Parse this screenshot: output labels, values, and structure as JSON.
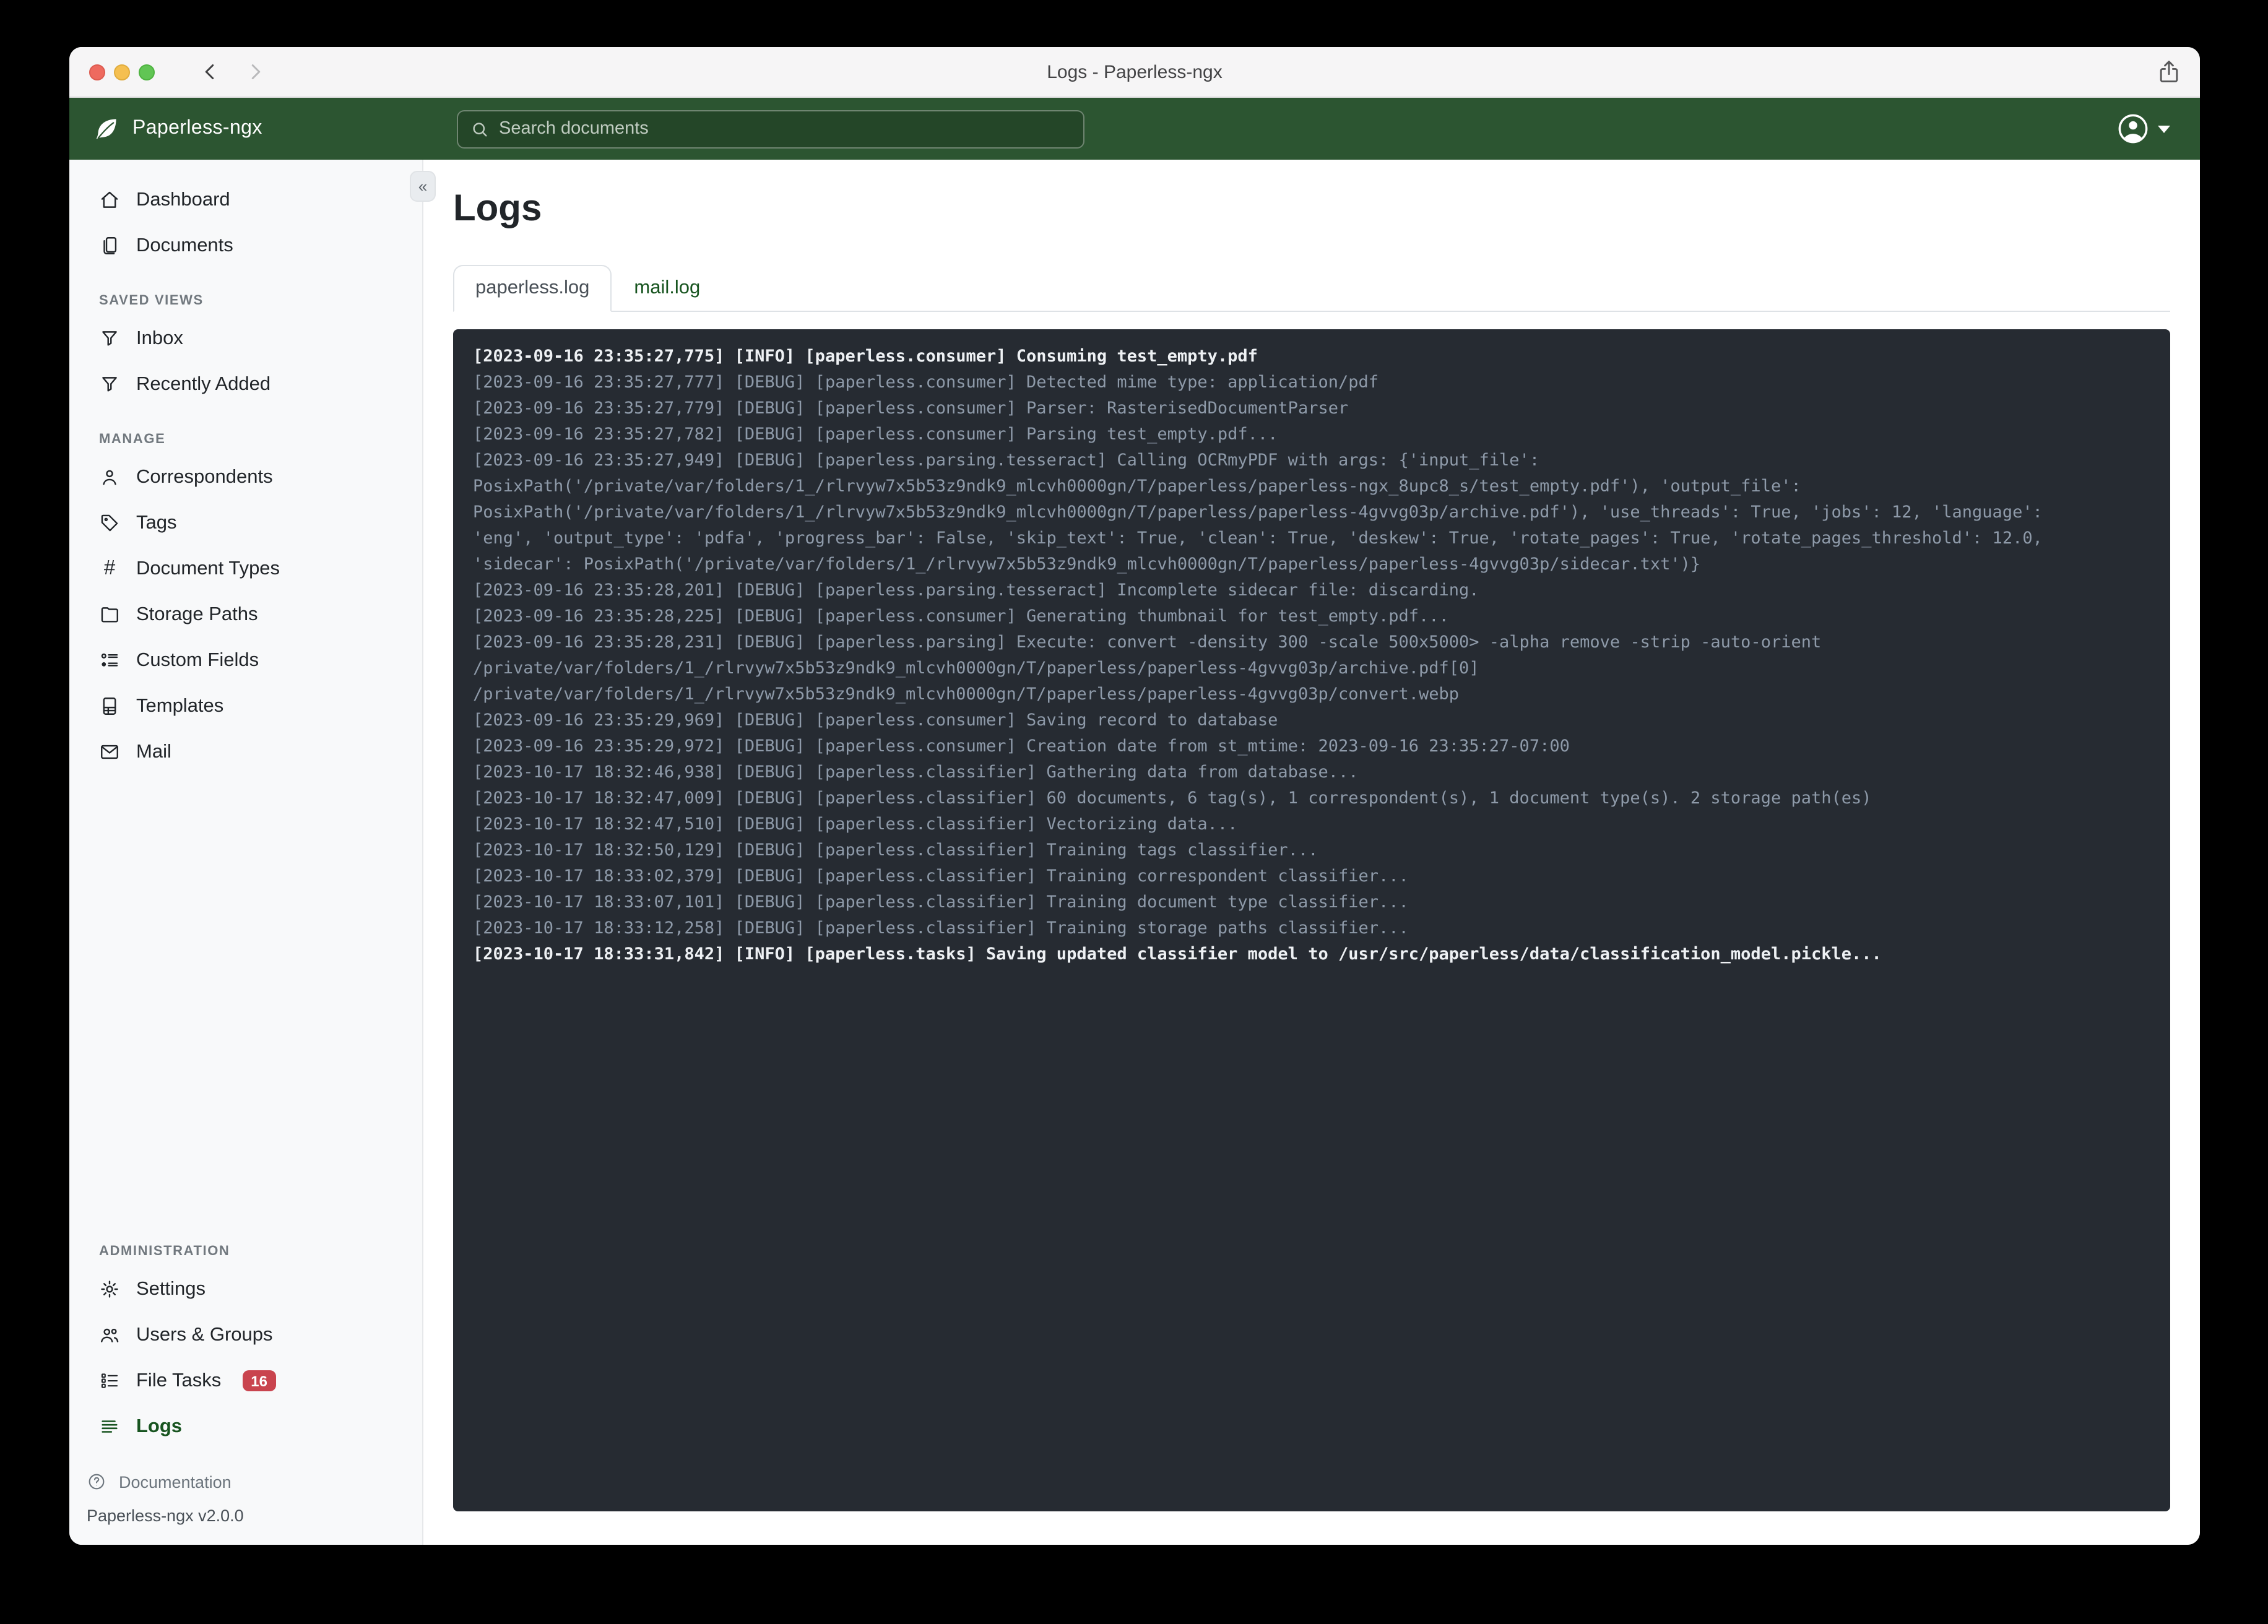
{
  "window": {
    "title": "Logs - Paperless-ngx"
  },
  "header": {
    "brand": "Paperless-ngx",
    "search": {
      "placeholder": "Search documents"
    }
  },
  "colors": {
    "navbar_green": "#2c5531",
    "accent_green": "#17541f",
    "badge_red": "#c9444e",
    "log_background": "#262b32",
    "log_debug_text": "#8e9aa9",
    "log_info_text": "#eef1f4",
    "sidebar_background": "#f8f9fa"
  },
  "sidebar": {
    "primary": [
      {
        "label": "Dashboard",
        "icon": "house-icon"
      },
      {
        "label": "Documents",
        "icon": "files-icon"
      }
    ],
    "saved_views_heading": "SAVED VIEWS",
    "saved_views": [
      {
        "label": "Inbox",
        "icon": "funnel-icon"
      },
      {
        "label": "Recently Added",
        "icon": "funnel-icon"
      }
    ],
    "manage_heading": "MANAGE",
    "manage": [
      {
        "label": "Correspondents",
        "icon": "person-icon"
      },
      {
        "label": "Tags",
        "icon": "tag-icon"
      },
      {
        "label": "Document Types",
        "icon": "hash-icon"
      },
      {
        "label": "Storage Paths",
        "icon": "folder-icon"
      },
      {
        "label": "Custom Fields",
        "icon": "ui-radios-icon"
      },
      {
        "label": "Templates",
        "icon": "file-ruled-icon"
      },
      {
        "label": "Mail",
        "icon": "envelope-icon"
      }
    ],
    "admin_heading": "ADMINISTRATION",
    "admin": [
      {
        "label": "Settings",
        "icon": "gear-icon"
      },
      {
        "label": "Users & Groups",
        "icon": "people-icon"
      },
      {
        "label": "File Tasks",
        "icon": "list-task-icon",
        "badge": "16"
      },
      {
        "label": "Logs",
        "icon": "text-left-icon",
        "active": true
      }
    ],
    "footer": {
      "documentation": "Documentation",
      "version": "Paperless-ngx v2.0.0"
    }
  },
  "main": {
    "title": "Logs",
    "tabs": [
      {
        "label": "paperless.log",
        "active": true
      },
      {
        "label": "mail.log",
        "active": false
      }
    ],
    "log_lines": [
      {
        "level": "info",
        "text": "[2023-09-16 23:35:27,775] [INFO] [paperless.consumer] Consuming test_empty.pdf"
      },
      {
        "level": "debug",
        "text": "[2023-09-16 23:35:27,777] [DEBUG] [paperless.consumer] Detected mime type: application/pdf"
      },
      {
        "level": "debug",
        "text": "[2023-09-16 23:35:27,779] [DEBUG] [paperless.consumer] Parser: RasterisedDocumentParser"
      },
      {
        "level": "debug",
        "text": "[2023-09-16 23:35:27,782] [DEBUG] [paperless.consumer] Parsing test_empty.pdf..."
      },
      {
        "level": "debug",
        "text": "[2023-09-16 23:35:27,949] [DEBUG] [paperless.parsing.tesseract] Calling OCRmyPDF with args: {'input_file':"
      },
      {
        "level": "debug",
        "text": "PosixPath('/private/var/folders/1_/rlrvyw7x5b53z9ndk9_mlcvh0000gn/T/paperless/paperless-ngx_8upc8_s/test_empty.pdf'), 'output_file':"
      },
      {
        "level": "debug",
        "text": "PosixPath('/private/var/folders/1_/rlrvyw7x5b53z9ndk9_mlcvh0000gn/T/paperless/paperless-4gvvg03p/archive.pdf'), 'use_threads': True, 'jobs': 12, 'language':"
      },
      {
        "level": "debug",
        "text": "'eng', 'output_type': 'pdfa', 'progress_bar': False, 'skip_text': True, 'clean': True, 'deskew': True, 'rotate_pages': True, 'rotate_pages_threshold': 12.0,"
      },
      {
        "level": "debug",
        "text": "'sidecar': PosixPath('/private/var/folders/1_/rlrvyw7x5b53z9ndk9_mlcvh0000gn/T/paperless/paperless-4gvvg03p/sidecar.txt')}"
      },
      {
        "level": "debug",
        "text": "[2023-09-16 23:35:28,201] [DEBUG] [paperless.parsing.tesseract] Incomplete sidecar file: discarding."
      },
      {
        "level": "debug",
        "text": "[2023-09-16 23:35:28,225] [DEBUG] [paperless.consumer] Generating thumbnail for test_empty.pdf..."
      },
      {
        "level": "debug",
        "text": "[2023-09-16 23:35:28,231] [DEBUG] [paperless.parsing] Execute: convert -density 300 -scale 500x5000> -alpha remove -strip -auto-orient"
      },
      {
        "level": "debug",
        "text": "/private/var/folders/1_/rlrvyw7x5b53z9ndk9_mlcvh0000gn/T/paperless/paperless-4gvvg03p/archive.pdf[0]"
      },
      {
        "level": "debug",
        "text": "/private/var/folders/1_/rlrvyw7x5b53z9ndk9_mlcvh0000gn/T/paperless/paperless-4gvvg03p/convert.webp"
      },
      {
        "level": "debug",
        "text": "[2023-09-16 23:35:29,969] [DEBUG] [paperless.consumer] Saving record to database"
      },
      {
        "level": "debug",
        "text": "[2023-09-16 23:35:29,972] [DEBUG] [paperless.consumer] Creation date from st_mtime: 2023-09-16 23:35:27-07:00"
      },
      {
        "level": "debug",
        "text": "[2023-10-17 18:32:46,938] [DEBUG] [paperless.classifier] Gathering data from database..."
      },
      {
        "level": "debug",
        "text": "[2023-10-17 18:32:47,009] [DEBUG] [paperless.classifier] 60 documents, 6 tag(s), 1 correspondent(s), 1 document type(s). 2 storage path(es)"
      },
      {
        "level": "debug",
        "text": "[2023-10-17 18:32:47,510] [DEBUG] [paperless.classifier] Vectorizing data..."
      },
      {
        "level": "debug",
        "text": "[2023-10-17 18:32:50,129] [DEBUG] [paperless.classifier] Training tags classifier..."
      },
      {
        "level": "debug",
        "text": "[2023-10-17 18:33:02,379] [DEBUG] [paperless.classifier] Training correspondent classifier..."
      },
      {
        "level": "debug",
        "text": "[2023-10-17 18:33:07,101] [DEBUG] [paperless.classifier] Training document type classifier..."
      },
      {
        "level": "debug",
        "text": "[2023-10-17 18:33:12,258] [DEBUG] [paperless.classifier] Training storage paths classifier..."
      },
      {
        "level": "info",
        "text": "[2023-10-17 18:33:31,842] [INFO] [paperless.tasks] Saving updated classifier model to /usr/src/paperless/data/classification_model.pickle..."
      }
    ]
  }
}
